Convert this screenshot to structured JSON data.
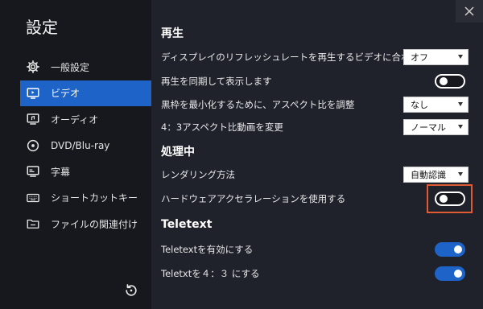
{
  "sidebar": {
    "title": "設定",
    "items": [
      {
        "label": "一般設定",
        "icon": "gear-icon"
      },
      {
        "label": "ビデオ",
        "icon": "monitor-icon",
        "active": true
      },
      {
        "label": "オーディオ",
        "icon": "audio-icon"
      },
      {
        "label": "DVD/Blu-ray",
        "icon": "disc-icon"
      },
      {
        "label": "字幕",
        "icon": "subtitle-icon"
      },
      {
        "label": "ショートカットキー",
        "icon": "keyboard-icon"
      },
      {
        "label": "ファイルの関連付け",
        "icon": "folder-icon"
      }
    ],
    "reset_icon": "reset-icon"
  },
  "close_icon": "close-icon",
  "sections": {
    "playback": {
      "title": "再生",
      "refresh_rate": {
        "label": "ディスプレイのリフレッシュレートを再生するビデオに合わせる",
        "value": "オフ"
      },
      "sync_display": {
        "label": "再生を同期して表示します",
        "toggle": "off"
      },
      "aspect_adjust": {
        "label": "黒枠を最小化するために、アスペクト比を調整",
        "value": "なし"
      },
      "aspect_change": {
        "label": "4：3アスペクト比動画を変更",
        "value": "ノーマル"
      }
    },
    "processing": {
      "title": "処理中",
      "rendering": {
        "label": "レンダリング方法",
        "value": "自動認識"
      },
      "hw_accel": {
        "label": "ハードウェアアクセラレーションを使用する",
        "toggle": "off"
      }
    },
    "teletext": {
      "title": "Teletext",
      "enable": {
        "label": "Teletextを有効にする",
        "toggle": "on"
      },
      "ratio": {
        "label": "Teletxtを４：３ にする",
        "toggle": "on"
      }
    }
  },
  "colors": {
    "accent": "#1e63c8",
    "sidebar_bg": "#16181d",
    "panel_bg": "#1f222b",
    "highlight": "#e05a33"
  }
}
